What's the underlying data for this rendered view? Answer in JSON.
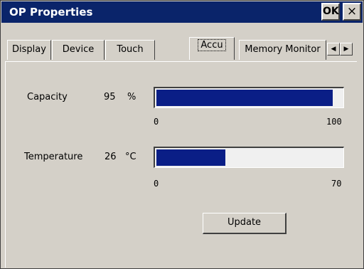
{
  "window": {
    "title": "OP Properties",
    "ok_label": "OK",
    "close_label": "×"
  },
  "tabs": [
    {
      "label": "Display",
      "active": false
    },
    {
      "label": "Device",
      "active": false
    },
    {
      "label": "Touch",
      "active": false
    },
    {
      "label": "Accu",
      "active": true
    },
    {
      "label": "Memory Monitor",
      "active": false
    }
  ],
  "tab_scroll": {
    "left": "◀",
    "right": "▶"
  },
  "capacity": {
    "label": "Capacity",
    "value": "95",
    "unit": "%",
    "min": "0",
    "max": "100",
    "fraction": 0.95
  },
  "temperature": {
    "label": "Temperature",
    "value": "26",
    "unit": "°C",
    "min": "0",
    "max": "70",
    "fraction": 0.371
  },
  "update_button": {
    "label": "Update"
  },
  "colors": {
    "titlebar": "#0a246a",
    "bar_fill": "#0a1e86",
    "face": "#d4d0c8"
  }
}
